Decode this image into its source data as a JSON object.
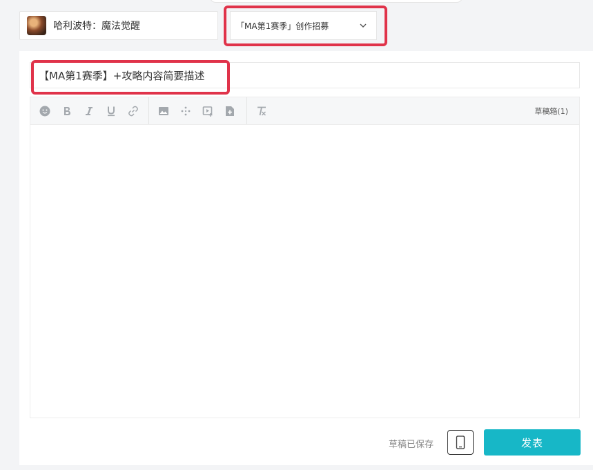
{
  "game_selector": {
    "name": "哈利波特：魔法觉醒",
    "icon": "game-avatar"
  },
  "category_select": {
    "selected": "「MA第1赛季」创作招募",
    "icon": "chevron-down-icon"
  },
  "title_input": {
    "value": "【MA第1赛季】+攻略内容简要描述"
  },
  "toolbar": {
    "groups": [
      [
        "emoji-icon",
        "bold-icon",
        "italic-icon",
        "underline-icon",
        "link-icon"
      ],
      [
        "image-icon",
        "sparkle-icon",
        "video-icon",
        "add-page-icon"
      ],
      [
        "clear-format-icon"
      ]
    ],
    "drafts_label": "草稿箱(1)"
  },
  "footer": {
    "saved_status": "草稿已保存",
    "preview_icon": "mobile-phone-icon",
    "publish_label": "发表"
  },
  "colors": {
    "accent": "#17b7c7",
    "highlight_border": "#e0334a"
  }
}
